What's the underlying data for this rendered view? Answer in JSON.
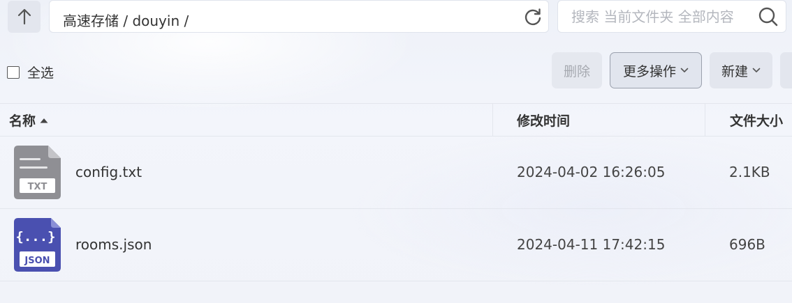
{
  "toolbar": {
    "up_icon": "arrow-up-icon",
    "path": "高速存储 / douyin /",
    "refresh_icon": "refresh-icon",
    "search_placeholder": "搜索 当前文件夹 全部内容",
    "search_value": "",
    "search_icon": "search-icon"
  },
  "actions": {
    "select_all_label": "全选",
    "select_all_checked": false,
    "delete_label": "删除",
    "more_label": "更多操作",
    "new_label": "新建"
  },
  "table": {
    "columns": {
      "name": "名称",
      "mtime": "修改时间",
      "size": "文件大小"
    },
    "sort": {
      "column": "name",
      "direction": "ascending"
    },
    "rows": [
      {
        "icon": "txt-file-icon",
        "icon_label": "TXT",
        "name": "config.txt",
        "mtime": "2024-04-02 16:26:05",
        "size": "2.1KB"
      },
      {
        "icon": "json-file-icon",
        "icon_label": "JSON",
        "icon_glyph": "{...}",
        "name": "rooms.json",
        "mtime": "2024-04-11 17:42:15",
        "size": "696B"
      }
    ]
  },
  "colors": {
    "background": "#eef1f8",
    "txt_icon": "#8f8f94",
    "json_icon": "#4a50b0",
    "disabled_text": "#a6a9b0"
  }
}
